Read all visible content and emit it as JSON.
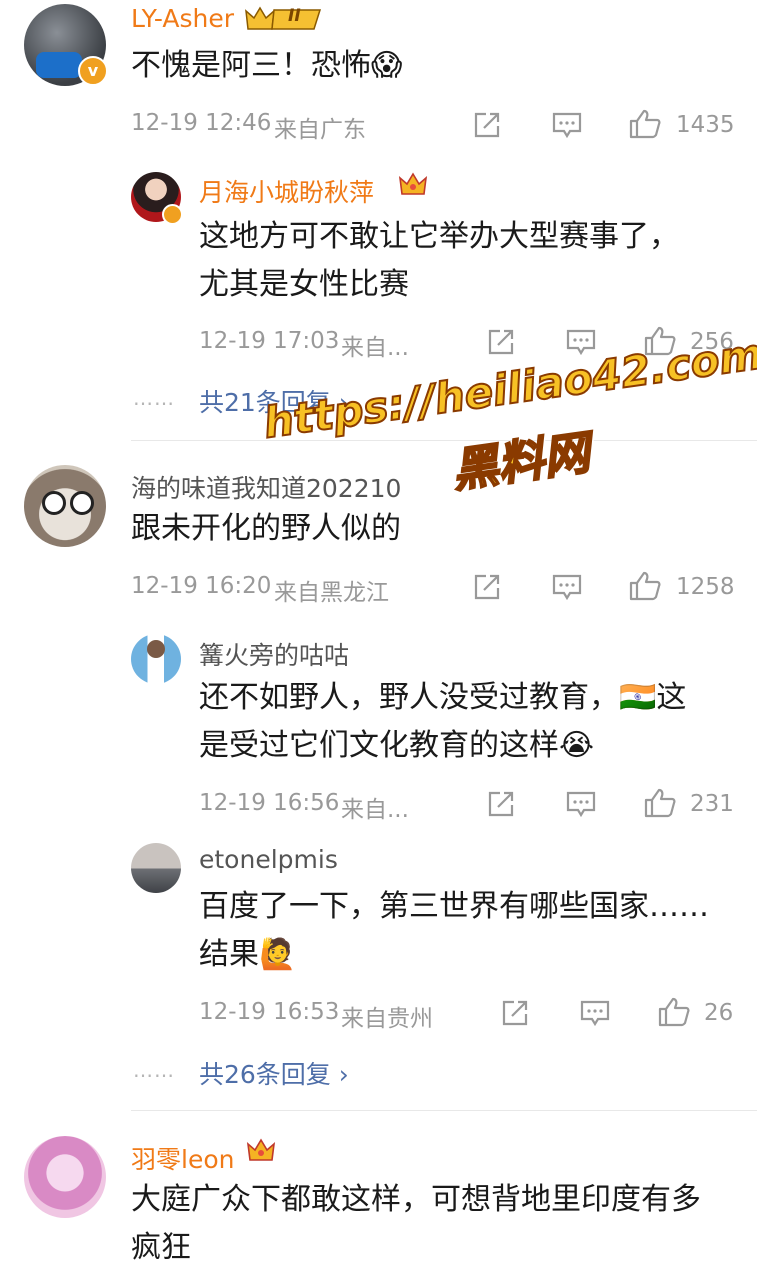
{
  "comments": [
    {
      "name": "LY-Asher",
      "badge_text": "II",
      "text": "不愧是阿三！恐怖😱",
      "time": "12-19 12:46",
      "location": "来自广东",
      "likes": "1435",
      "replies": [
        {
          "name": "月海小城盼秋萍",
          "text_line1": "这地方可不敢让它举办大型赛事了，",
          "text_line2": "尤其是女性比赛",
          "time": "12-19 17:03",
          "location": "来自...",
          "likes": "256"
        }
      ],
      "more_replies": "共21条回复 ›"
    },
    {
      "name": "海的味道我知道202210",
      "text": "跟未开化的野人似的",
      "time": "12-19 16:20",
      "location": "来自黑龙江",
      "likes": "1258",
      "replies": [
        {
          "name": "篝火旁的咕咕",
          "text_line1": "还不如野人，野人没受过教育，🇮🇳这",
          "text_line2": "是受过它们文化教育的这样😭",
          "time": "12-19 16:56",
          "location": "来自...",
          "likes": "231"
        },
        {
          "name": "etonelpmis",
          "text_line1": "百度了一下，第三世界有哪些国家……",
          "text_line2": "结果🙋",
          "time": "12-19 16:53",
          "location": "来自贵州",
          "likes": "26"
        }
      ],
      "more_replies": "共26条回复 ›"
    },
    {
      "name": "羽零leon",
      "text_line1": "大庭广众下都敢这样，可想背地里印度有多",
      "text_line2": "疯狂"
    }
  ],
  "watermark": {
    "line1": "https://heiliao42.com",
    "line2": "黑料网"
  },
  "dots": "……",
  "colors": {
    "name_orange": "#f07a17",
    "link_blue": "#4e6ea8",
    "meta_gray": "#999999",
    "watermark_fill": "#f7c125"
  }
}
